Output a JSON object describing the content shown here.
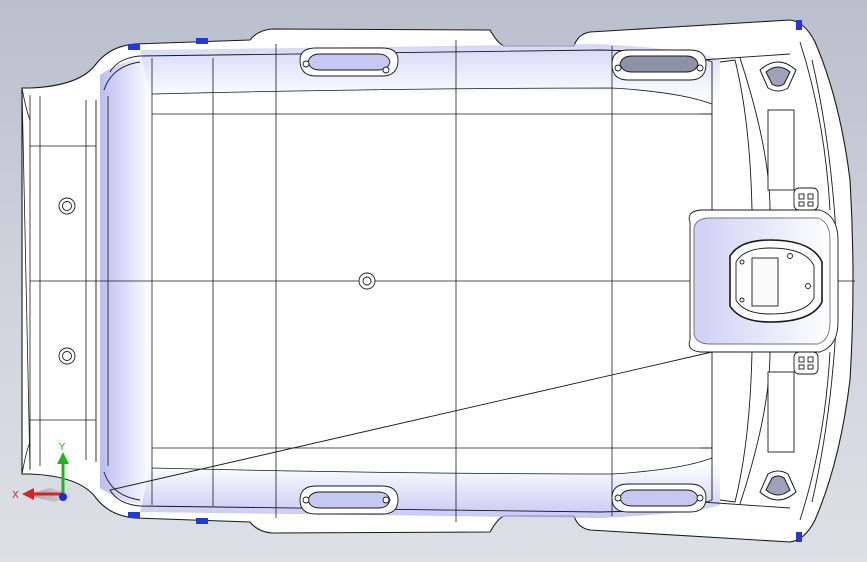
{
  "view": {
    "background_top": "#b9bfcc",
    "background_bottom": "#dde0e6",
    "part_fill": "#ffffff",
    "edge_color": "#1a1a1a",
    "shade_color": "#b7baf2",
    "clip_color": "#2238d8"
  },
  "triad": {
    "x_label": "X",
    "y_label": "Y",
    "x_color": "#e02020",
    "y_color": "#18b818",
    "z_color": "#1a2cd8"
  }
}
